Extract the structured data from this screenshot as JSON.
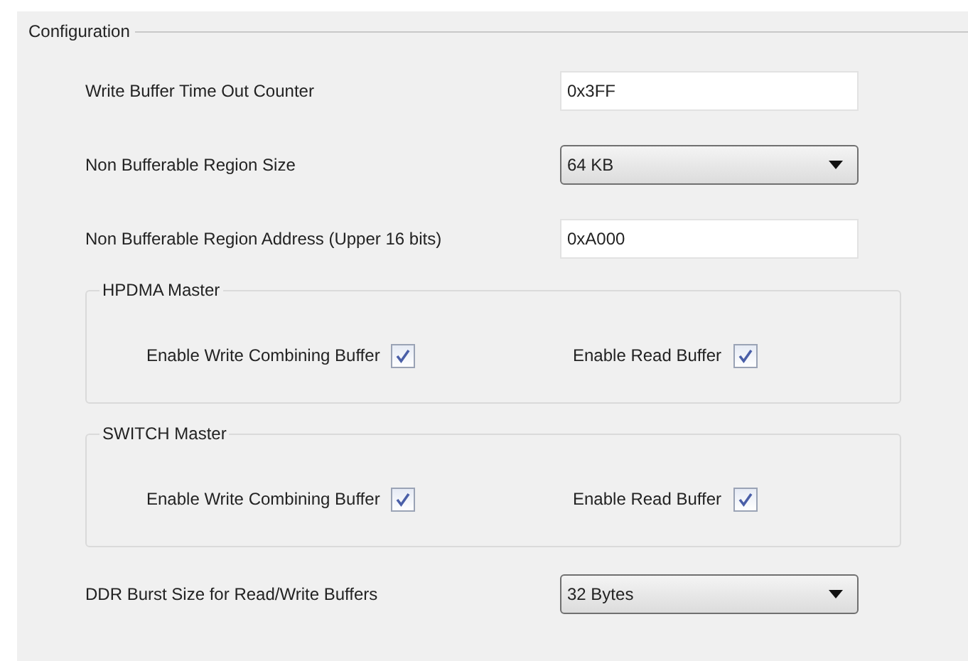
{
  "section": {
    "title": "Configuration"
  },
  "items": [
    {
      "kind": "input",
      "label": "Write Buffer Time Out Counter",
      "value": "0x3FF"
    },
    {
      "kind": "dropdown",
      "label": "Non Bufferable Region Size",
      "value": "64 KB"
    },
    {
      "kind": "input",
      "label": "Non Bufferable Region Address (Upper 16 bits)",
      "value": "0xA000"
    },
    {
      "kind": "group",
      "title": "HPDMA Master",
      "checkboxes": [
        {
          "label": "Enable Write Combining Buffer",
          "checked": true
        },
        {
          "label": "Enable Read Buffer",
          "checked": true
        }
      ]
    },
    {
      "kind": "group",
      "title": "SWITCH Master",
      "checkboxes": [
        {
          "label": "Enable Write Combining Buffer",
          "checked": true
        },
        {
          "label": "Enable Read Buffer",
          "checked": true
        }
      ]
    },
    {
      "kind": "dropdown",
      "label": "DDR Burst Size for Read/Write Buffers",
      "value": "32 Bytes"
    }
  ]
}
